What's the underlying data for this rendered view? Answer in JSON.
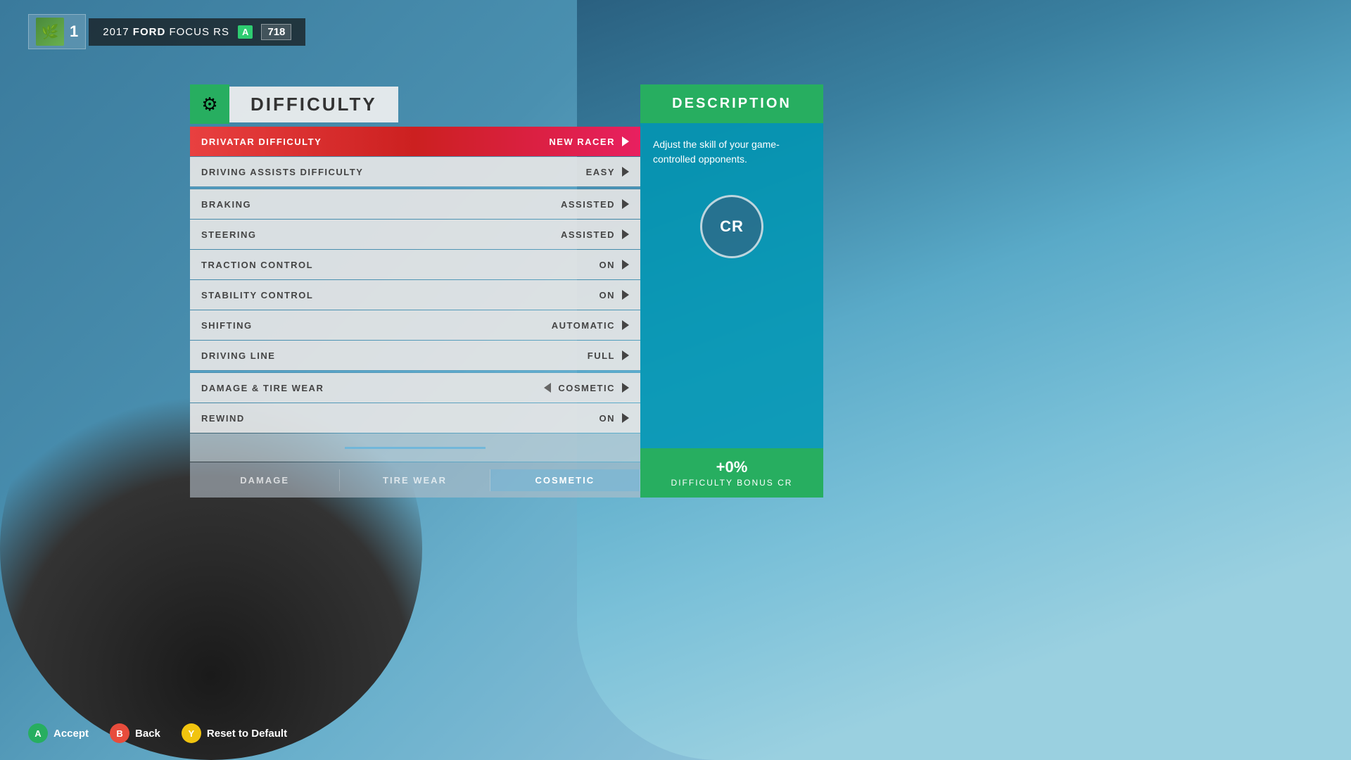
{
  "header": {
    "player_level": "1",
    "car_year": "2017",
    "car_make": "FORD",
    "car_model": "FOCUS RS",
    "car_class": "A",
    "car_rating": "718"
  },
  "title": {
    "icon": "⚙",
    "text": "DIFFICULTY"
  },
  "menu": {
    "rows": [
      {
        "label": "DRIVATAR DIFFICULTY",
        "value": "NEW RACER",
        "active": true,
        "has_left_arrow": false
      },
      {
        "label": "DRIVING ASSISTS DIFFICULTY",
        "value": "EASY",
        "active": false,
        "has_left_arrow": false
      },
      {
        "label": "BRAKING",
        "value": "ASSISTED",
        "active": false,
        "has_left_arrow": false
      },
      {
        "label": "STEERING",
        "value": "ASSISTED",
        "active": false,
        "has_left_arrow": false
      },
      {
        "label": "TRACTION CONTROL",
        "value": "ON",
        "active": false,
        "has_left_arrow": false
      },
      {
        "label": "STABILITY CONTROL",
        "value": "ON",
        "active": false,
        "has_left_arrow": false
      },
      {
        "label": "SHIFTING",
        "value": "AUTOMATIC",
        "active": false,
        "has_left_arrow": false
      },
      {
        "label": "DRIVING LINE",
        "value": "FULL",
        "active": false,
        "has_left_arrow": false
      },
      {
        "label": "DAMAGE & TIRE WEAR",
        "value": "COSMETIC",
        "active": false,
        "has_left_arrow": true
      },
      {
        "label": "REWIND",
        "value": "ON",
        "active": false,
        "has_left_arrow": false
      }
    ],
    "damage_tiers": [
      {
        "label": "DAMAGE",
        "selected": false
      },
      {
        "label": "TIRE WEAR",
        "selected": false
      },
      {
        "label": "COSMETIC",
        "selected": true
      }
    ]
  },
  "description": {
    "header": "DESCRIPTION",
    "body_text": "Adjust the skill of your game-controlled opponents.",
    "cr_badge": "CR",
    "bonus_percent": "+0%",
    "bonus_label": "DIFFICULTY BONUS CR"
  },
  "controls": [
    {
      "button": "A",
      "label": "Accept",
      "color": "btn-a"
    },
    {
      "button": "B",
      "label": "Back",
      "color": "btn-b"
    },
    {
      "button": "Y",
      "label": "Reset to Default",
      "color": "btn-y"
    }
  ]
}
